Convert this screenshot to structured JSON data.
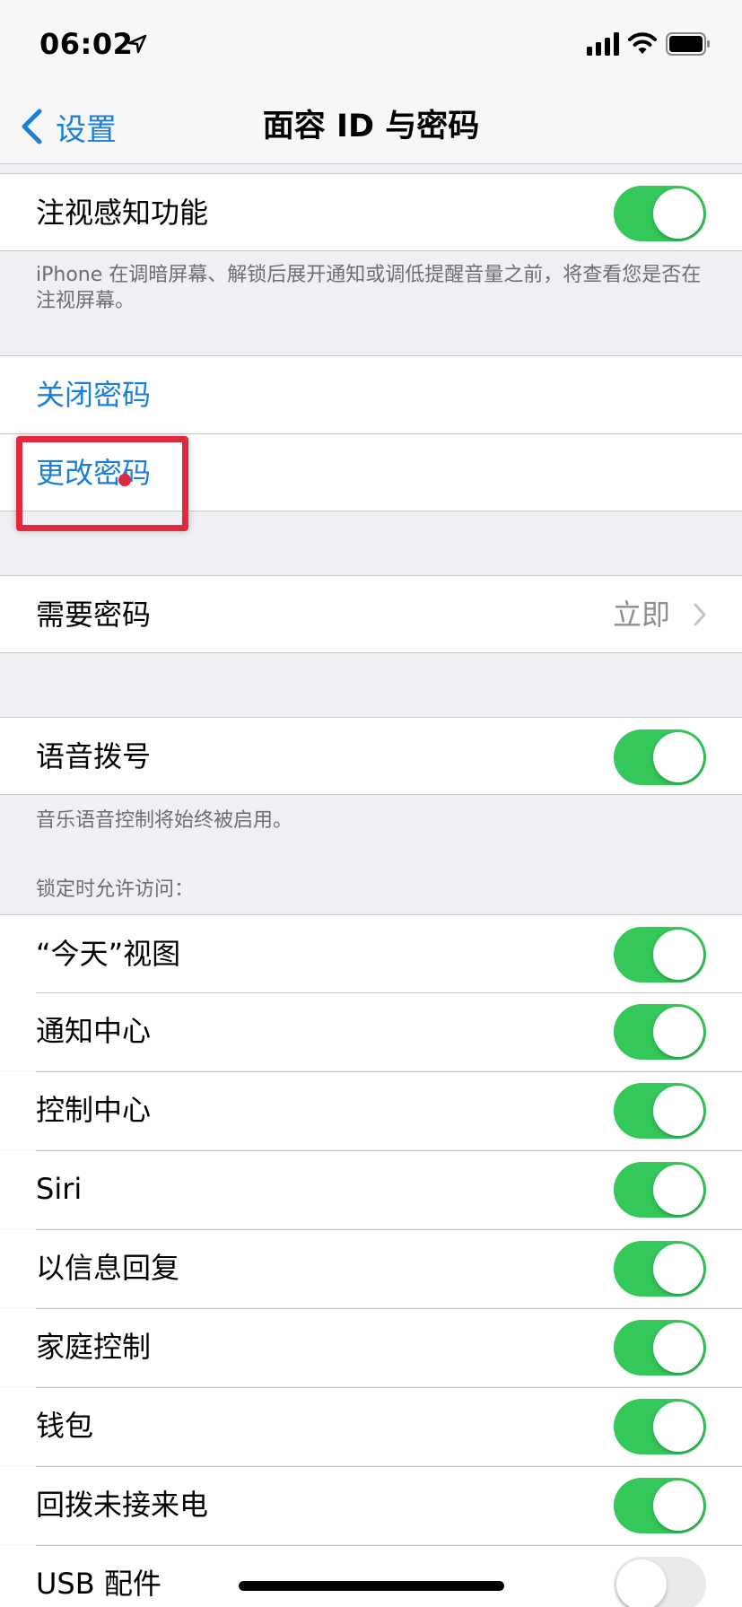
{
  "status_bar": {
    "time": "06:02"
  },
  "nav": {
    "back_label": "设置",
    "title": "面容 ID 与密码"
  },
  "attention": {
    "label": "注视感知功能",
    "enabled": true,
    "footer": "iPhone 在调暗屏幕、解锁后展开通知或调低提醒音量之前，将查看您是否在注视屏幕。"
  },
  "passcode": {
    "turn_off_label": "关闭密码",
    "change_label": "更改密码"
  },
  "require_passcode": {
    "label": "需要密码",
    "value": "立即"
  },
  "voice_dial": {
    "label": "语音拨号",
    "enabled": true,
    "footer": "音乐语音控制将始终被启用。"
  },
  "locked_access": {
    "header": "锁定时允许访问：",
    "items": [
      {
        "label": "“今天”视图",
        "enabled": true
      },
      {
        "label": "通知中心",
        "enabled": true
      },
      {
        "label": "控制中心",
        "enabled": true
      },
      {
        "label": "Siri",
        "enabled": true
      },
      {
        "label": "以信息回复",
        "enabled": true
      },
      {
        "label": "家庭控制",
        "enabled": true
      },
      {
        "label": "钱包",
        "enabled": true
      },
      {
        "label": "回拨未接来电",
        "enabled": true
      },
      {
        "label": "USB 配件",
        "enabled": false
      }
    ]
  },
  "colors": {
    "accent": "#1a7fd8",
    "toggle_on": "#34c759",
    "highlight": "#e0283f"
  }
}
